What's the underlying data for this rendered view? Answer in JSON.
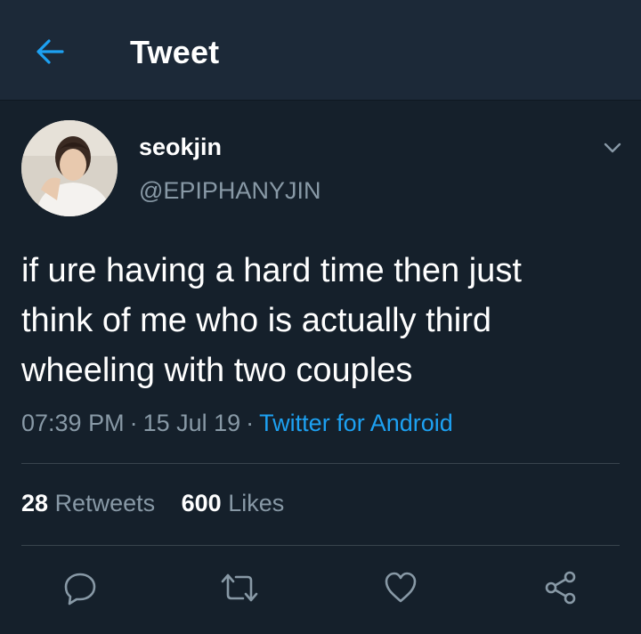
{
  "header": {
    "title": "Tweet",
    "back_icon": "arrow-left-icon"
  },
  "colors": {
    "background": "#15202b",
    "header_background": "#1c2938",
    "accent": "#1da1f2",
    "secondary_text": "#8899a6",
    "divider": "#38444d"
  },
  "tweet": {
    "author": {
      "display_name": "seokjin",
      "handle": "@EPIPHANYJIN"
    },
    "text_lines": [
      "if ure having a hard time then just",
      "think of me who is actually third",
      "wheeling with two couples"
    ],
    "time": "07:39 PM",
    "separator": "·",
    "date": "15 Jul 19",
    "source": "Twitter for Android"
  },
  "stats": {
    "retweets_count": "28",
    "retweets_label": "Retweets",
    "likes_count": "600",
    "likes_label": "Likes"
  },
  "actions": [
    {
      "name": "reply",
      "icon": "reply-bubble-icon"
    },
    {
      "name": "retweet",
      "icon": "retweet-icon"
    },
    {
      "name": "like",
      "icon": "heart-icon"
    },
    {
      "name": "share",
      "icon": "share-icon"
    }
  ]
}
